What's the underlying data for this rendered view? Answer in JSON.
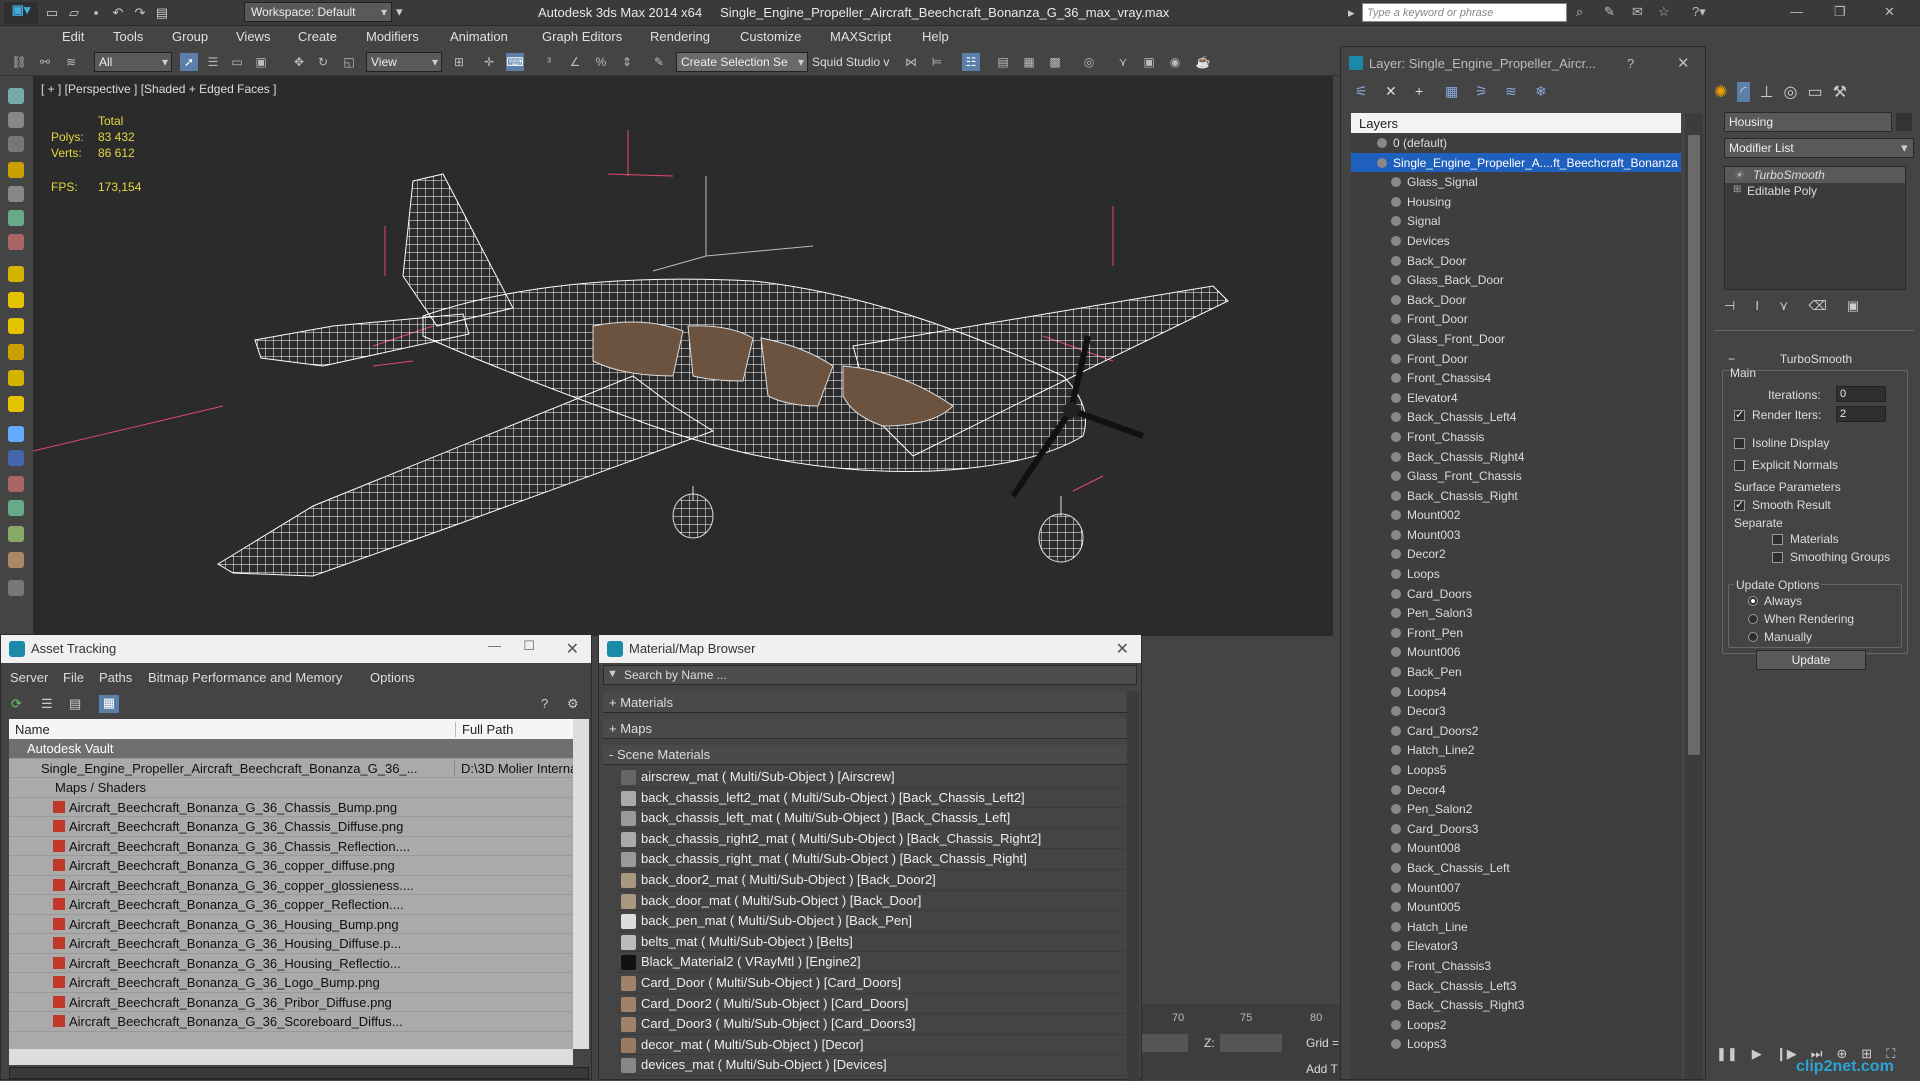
{
  "titlebar": {
    "workspace": "Workspace: Default",
    "app": "Autodesk 3ds Max  2014 x64",
    "file": "Single_Engine_Propeller_Aircraft_Beechcraft_Bonanza_G_36_max_vray.max",
    "search_placeholder": "Type a keyword or phrase"
  },
  "menu": [
    "Edit",
    "Tools",
    "Group",
    "Views",
    "Create",
    "Modifiers",
    "Animation",
    "Graph Editors",
    "Rendering",
    "Customize",
    "MAXScript",
    "Help"
  ],
  "toolbar": {
    "filter": "All",
    "refcoord": "View",
    "selection_set": "Create Selection Se",
    "studio": "Squid Studio v"
  },
  "viewport": {
    "label": "[ + ] [Perspective ] [Shaded + Edged Faces ]",
    "stats": {
      "total_label": "Total",
      "polys_label": "Polys:",
      "polys": "83 432",
      "verts_label": "Verts:",
      "verts": "86 612",
      "fps_label": "FPS:",
      "fps": "173,154"
    }
  },
  "asset_tracking": {
    "title": "Asset Tracking",
    "menu": [
      "Server",
      "File",
      "Paths",
      "Bitmap Performance and Memory",
      "Options"
    ],
    "columns": [
      "Name",
      "Full Path"
    ],
    "rows": [
      {
        "name": "Autodesk Vault",
        "path": "",
        "indent": 1,
        "sel": true
      },
      {
        "name": "Single_Engine_Propeller_Aircraft_Beechcraft_Bonanza_G_36_...",
        "path": "D:\\3D Molier Interna",
        "indent": 2
      },
      {
        "name": "Maps / Shaders",
        "path": "",
        "indent": 3
      },
      {
        "name": "Aircraft_Beechcraft_Bonanza_G_36_Chassis_Bump.png",
        "path": "",
        "indent": 4
      },
      {
        "name": "Aircraft_Beechcraft_Bonanza_G_36_Chassis_Diffuse.png",
        "path": "",
        "indent": 4
      },
      {
        "name": "Aircraft_Beechcraft_Bonanza_G_36_Chassis_Reflection....",
        "path": "",
        "indent": 4
      },
      {
        "name": "Aircraft_Beechcraft_Bonanza_G_36_copper_diffuse.png",
        "path": "",
        "indent": 4
      },
      {
        "name": "Aircraft_Beechcraft_Bonanza_G_36_copper_glossieness....",
        "path": "",
        "indent": 4
      },
      {
        "name": "Aircraft_Beechcraft_Bonanza_G_36_copper_Reflection....",
        "path": "",
        "indent": 4
      },
      {
        "name": "Aircraft_Beechcraft_Bonanza_G_36_Housing_Bump.png",
        "path": "",
        "indent": 4
      },
      {
        "name": "Aircraft_Beechcraft_Bonanza_G_36_Housing_Diffuse.p...",
        "path": "",
        "indent": 4
      },
      {
        "name": "Aircraft_Beechcraft_Bonanza_G_36_Housing_Reflectio...",
        "path": "",
        "indent": 4
      },
      {
        "name": "Aircraft_Beechcraft_Bonanza_G_36_Logo_Bump.png",
        "path": "",
        "indent": 4
      },
      {
        "name": "Aircraft_Beechcraft_Bonanza_G_36_Pribor_Diffuse.png",
        "path": "",
        "indent": 4
      },
      {
        "name": "Aircraft_Beechcraft_Bonanza_G_36_Scoreboard_Diffus...",
        "path": "",
        "indent": 4
      }
    ]
  },
  "material_browser": {
    "title": "Material/Map Browser",
    "search_placeholder": "Search by Name ...",
    "sections": [
      "+ Materials",
      "+ Maps",
      "- Scene Materials"
    ],
    "items": [
      {
        "label": "airscrew_mat  ( Multi/Sub-Object )  [Airscrew]",
        "swatch": "#666"
      },
      {
        "label": "back_chassis_left2_mat  ( Multi/Sub-Object )  [Back_Chassis_Left2]",
        "swatch": "#aaa"
      },
      {
        "label": "back_chassis_left_mat  ( Multi/Sub-Object )  [Back_Chassis_Left]",
        "swatch": "#999"
      },
      {
        "label": "back_chassis_right2_mat  ( Multi/Sub-Object )  [Back_Chassis_Right2]",
        "swatch": "#aaa"
      },
      {
        "label": "back_chassis_right_mat  ( Multi/Sub-Object )  [Back_Chassis_Right]",
        "swatch": "#999"
      },
      {
        "label": "back_door2_mat  ( Multi/Sub-Object )  [Back_Door2]",
        "swatch": "#a89880"
      },
      {
        "label": "back_door_mat  ( Multi/Sub-Object )  [Back_Door]",
        "swatch": "#a89880"
      },
      {
        "label": "back_pen_mat  ( Multi/Sub-Object )  [Back_Pen]",
        "swatch": "#ddd"
      },
      {
        "label": "belts_mat  ( Multi/Sub-Object )  [Belts]",
        "swatch": "#bbb"
      },
      {
        "label": "Black_Material2  ( VRayMtl )  [Engine2]",
        "swatch": "#111"
      },
      {
        "label": "Card_Door  ( Multi/Sub-Object )  [Card_Doors]",
        "swatch": "#a0826a"
      },
      {
        "label": "Card_Door2  ( Multi/Sub-Object )  [Card_Doors]",
        "swatch": "#a0826a"
      },
      {
        "label": "Card_Door3  ( Multi/Sub-Object )  [Card_Doors3]",
        "swatch": "#a0826a"
      },
      {
        "label": "decor_mat  ( Multi/Sub-Object )  [Decor]",
        "swatch": "#9a7a60"
      },
      {
        "label": "devices_mat  ( Multi/Sub-Object )  [Devices]",
        "swatch": "#888"
      }
    ]
  },
  "layer_explorer": {
    "title": "Layer: Single_Engine_Propeller_Aircr...",
    "help": "?",
    "header": "Layers",
    "root_default": "0 (default)",
    "root_selected": "Single_Engine_Propeller_A....ft_Beechcraft_Bonanza",
    "items": [
      "Glass_Signal",
      "Housing",
      "Signal",
      "Devices",
      "Back_Door",
      "Glass_Back_Door",
      "Back_Door",
      "Front_Door",
      "Glass_Front_Door",
      "Front_Door",
      "Front_Chassis4",
      "Elevator4",
      "Back_Chassis_Left4",
      "Front_Chassis",
      "Back_Chassis_Right4",
      "Glass_Front_Chassis",
      "Back_Chassis_Right",
      "Mount002",
      "Mount003",
      "Decor2",
      "Loops",
      "Card_Doors",
      "Pen_Salon3",
      "Front_Pen",
      "Mount006",
      "Back_Pen",
      "Loops4",
      "Decor3",
      "Card_Doors2",
      "Hatch_Line2",
      "Loops5",
      "Decor4",
      "Pen_Salon2",
      "Card_Doors3",
      "Mount008",
      "Back_Chassis_Left",
      "Mount007",
      "Mount005",
      "Hatch_Line",
      "Elevator3",
      "Front_Chassis3",
      "Back_Chassis_Left3",
      "Back_Chassis_Right3",
      "Loops2",
      "Loops3"
    ]
  },
  "command_panel": {
    "object_name": "Housing",
    "modifier_list": "Modifier List",
    "stack": [
      "TurboSmooth",
      "Editable Poly"
    ],
    "rollout": "TurboSmooth",
    "main": "Main",
    "iterations_label": "Iterations:",
    "iterations": "0",
    "render_iters_label": "Render Iters:",
    "render_iters": "2",
    "isoline": "Isoline Display",
    "explicit": "Explicit Normals",
    "surface": "Surface Parameters",
    "smooth_result": "Smooth Result",
    "separate": "Separate",
    "materials": "Materials",
    "smoothing_groups": "Smoothing Groups",
    "update_options": "Update Options",
    "always": "Always",
    "when_rendering": "When Rendering",
    "manually": "Manually",
    "update_btn": "Update"
  },
  "timeline": {
    "t70": "70",
    "t75": "75",
    "t80": "80",
    "z_label": "Z:",
    "grid": "Grid =",
    "add": "Add T"
  },
  "watermark": "clip2net.com"
}
